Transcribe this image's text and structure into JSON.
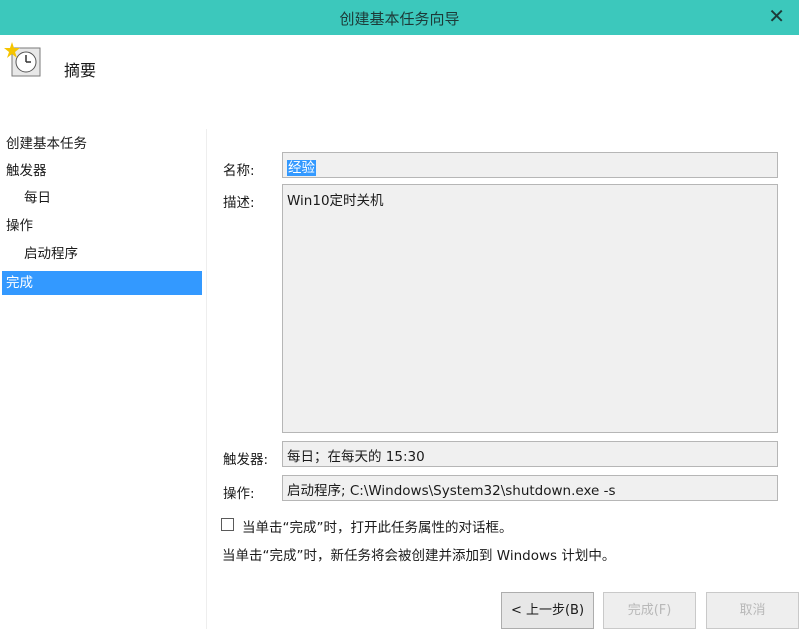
{
  "window": {
    "title": "创建基本任务向导",
    "close_glyph": "✕"
  },
  "header": {
    "title": "摘要",
    "icon": "scheduled-task-clock-icon"
  },
  "sidebar": {
    "items": [
      {
        "label": "创建基本任务"
      },
      {
        "label": "触发器"
      },
      {
        "label": "每日"
      },
      {
        "label": "操作"
      },
      {
        "label": "启动程序"
      },
      {
        "label": "完成",
        "selected": true
      }
    ]
  },
  "summary": {
    "name_label": "名称:",
    "name_value": "经验",
    "description_label": "描述:",
    "description_value": "Win10定时关机",
    "trigger_label": "触发器:",
    "trigger_value": "每日；在每天的 15:30",
    "action_label": "操作:",
    "action_value": "启动程序; C:\\Windows\\System32\\shutdown.exe -s",
    "open_properties_checkbox_label": "当单击“完成”时，打开此任务属性的对话框。",
    "open_properties_checked": false,
    "finish_note": "当单击“完成”时，新任务将会被创建并添加到 Windows 计划中。"
  },
  "buttons": {
    "back_label": "< 上一步(B)",
    "finish_label": "完成(F)",
    "cancel_label": "取消"
  },
  "colors": {
    "titlebar": "#3cc8bc",
    "selection": "#3399ff",
    "field_background": "#f0f0f0"
  }
}
